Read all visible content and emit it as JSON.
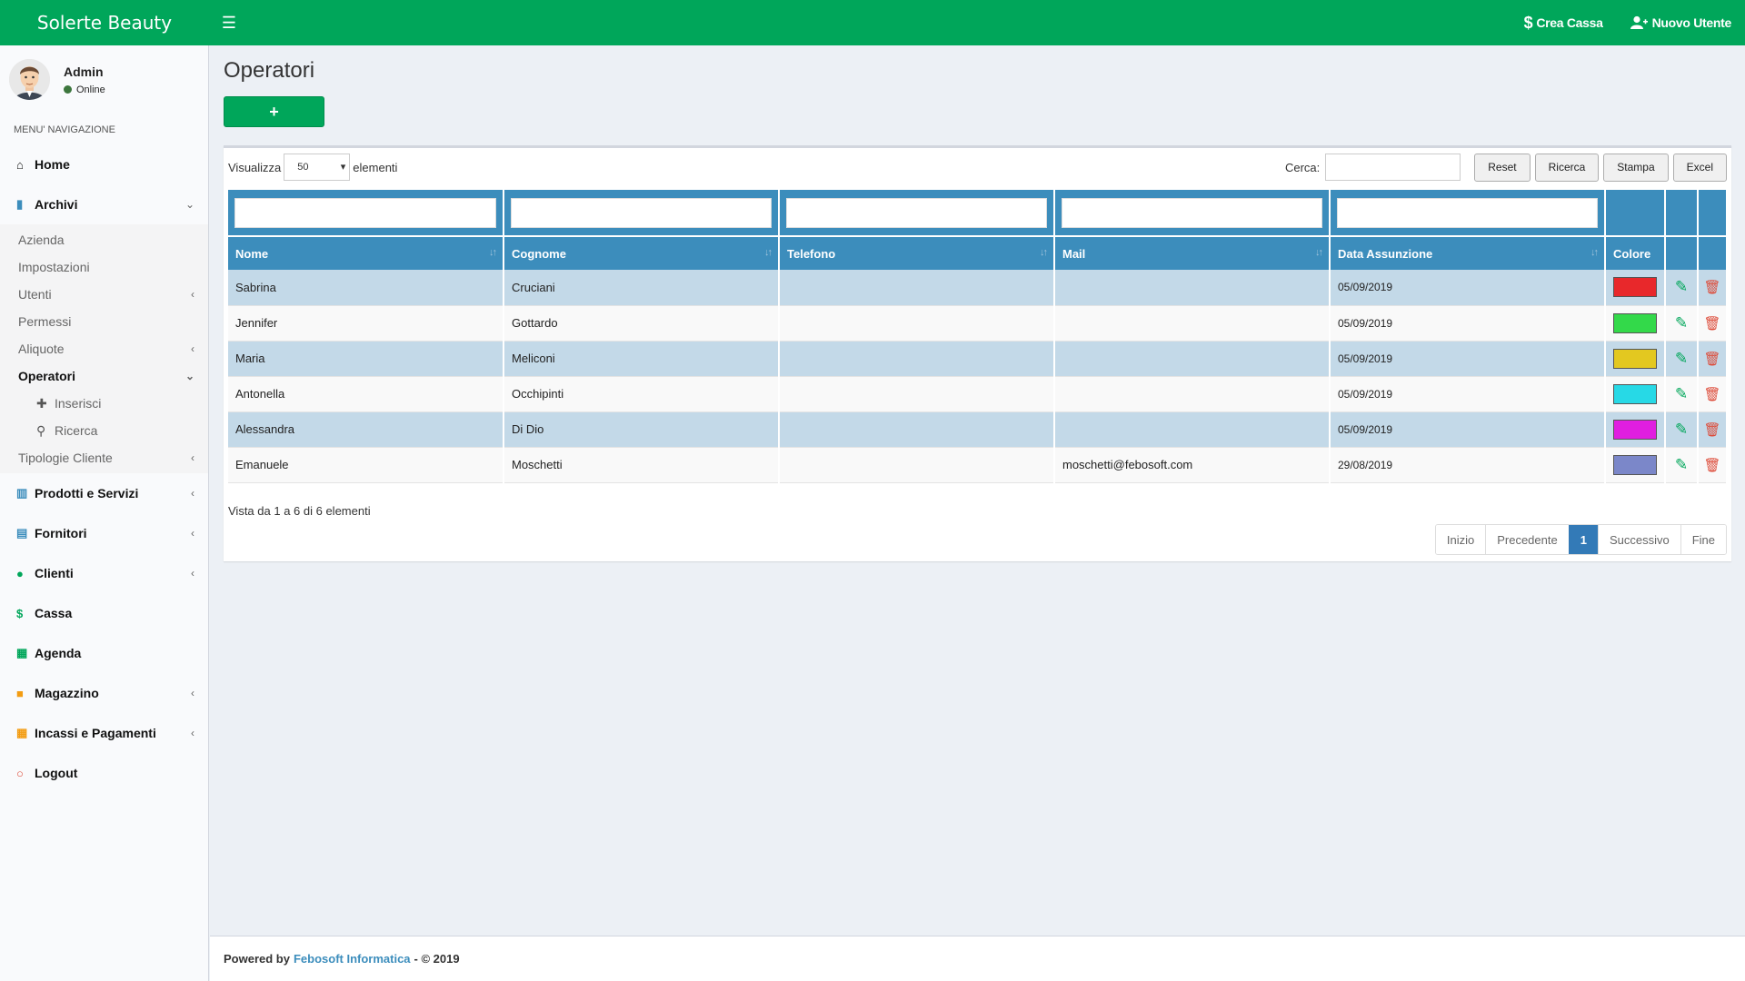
{
  "header": {
    "brand": "Solerte Beauty",
    "crea_cassa": "Crea Cassa",
    "nuovo_utente": "Nuovo Utente",
    "color": "#00a65a"
  },
  "user": {
    "name": "Admin",
    "status": "Online"
  },
  "sidebar": {
    "menu_header": "MENU' NAVIGAZIONE",
    "home": "Home",
    "archivi": "Archivi",
    "archivi_sub": {
      "azienda": "Azienda",
      "impostazioni": "Impostazioni",
      "utenti": "Utenti",
      "permessi": "Permessi",
      "aliquote": "Aliquote",
      "operatori": "Operatori",
      "inserisci": "Inserisci",
      "ricerca": "Ricerca",
      "tipologie": "Tipologie Cliente"
    },
    "prodotti": "Prodotti e Servizi",
    "fornitori": "Fornitori",
    "clienti": "Clienti",
    "cassa": "Cassa",
    "agenda": "Agenda",
    "magazzino": "Magazzino",
    "incassi": "Incassi e Pagamenti",
    "logout": "Logout"
  },
  "page": {
    "title": "Operatori",
    "add_label": "+"
  },
  "toolbar": {
    "visualizza": "Visualizza",
    "page_size": "50",
    "elementi": "elementi",
    "cerca": "Cerca:",
    "reset": "Reset",
    "ricerca": "Ricerca",
    "stampa": "Stampa",
    "excel": "Excel"
  },
  "table": {
    "columns": [
      "Nome",
      "Cognome",
      "Telefono",
      "Mail",
      "Data Assunzione",
      "Colore"
    ],
    "rows": [
      {
        "nome": "Sabrina",
        "cognome": "Cruciani",
        "telefono": "",
        "mail": "",
        "data": "05/09/2019",
        "colore": "#e8282b"
      },
      {
        "nome": "Jennifer",
        "cognome": "Gottardo",
        "telefono": "",
        "mail": "",
        "data": "05/09/2019",
        "colore": "#33d94a"
      },
      {
        "nome": "Maria",
        "cognome": "Meliconi",
        "telefono": "",
        "mail": "",
        "data": "05/09/2019",
        "colore": "#e3c820"
      },
      {
        "nome": "Antonella",
        "cognome": "Occhipinti",
        "telefono": "",
        "mail": "",
        "data": "05/09/2019",
        "colore": "#27d9e6"
      },
      {
        "nome": "Alessandra",
        "cognome": "Di Dio",
        "telefono": "",
        "mail": "",
        "data": "05/09/2019",
        "colore": "#e01ee0"
      },
      {
        "nome": "Emanuele",
        "cognome": "Moschetti",
        "telefono": "",
        "mail": "moschetti@febosoft.com",
        "data": "29/08/2019",
        "colore": "#7b87c9"
      }
    ]
  },
  "info": "Vista da 1 a 6 di 6 elementi",
  "pagination": {
    "inizio": "Inizio",
    "precedente": "Precedente",
    "current": "1",
    "successivo": "Successivo",
    "fine": "Fine"
  },
  "footer": {
    "powered": "Powered by",
    "company": "Febosoft Informatica",
    "copyright": "- © 2019"
  }
}
